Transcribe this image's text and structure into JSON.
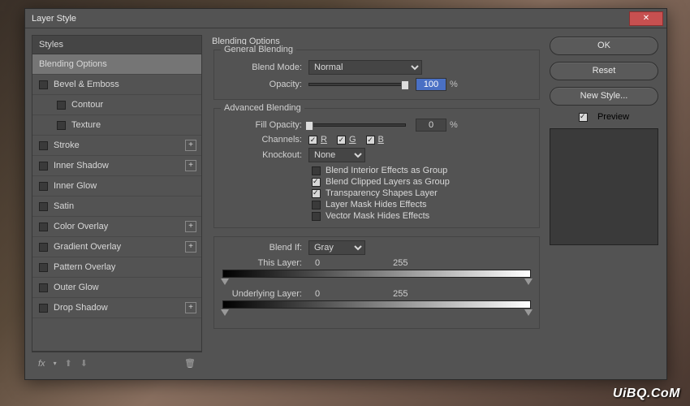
{
  "dialog": {
    "title": "Layer Style"
  },
  "sidebar": {
    "header": "Styles",
    "items": [
      {
        "label": "Blending Options",
        "selected": true,
        "checkbox": false
      },
      {
        "label": "Bevel & Emboss",
        "checkbox": true
      },
      {
        "label": "Contour",
        "checkbox": true,
        "sub": true
      },
      {
        "label": "Texture",
        "checkbox": true,
        "sub": true
      },
      {
        "label": "Stroke",
        "checkbox": true,
        "plus": true
      },
      {
        "label": "Inner Shadow",
        "checkbox": true,
        "plus": true
      },
      {
        "label": "Inner Glow",
        "checkbox": true
      },
      {
        "label": "Satin",
        "checkbox": true
      },
      {
        "label": "Color Overlay",
        "checkbox": true,
        "plus": true
      },
      {
        "label": "Gradient Overlay",
        "checkbox": true,
        "plus": true
      },
      {
        "label": "Pattern Overlay",
        "checkbox": true
      },
      {
        "label": "Outer Glow",
        "checkbox": true
      },
      {
        "label": "Drop Shadow",
        "checkbox": true,
        "plus": true
      }
    ],
    "fx_label": "fx"
  },
  "content": {
    "section_title": "Blending Options",
    "general": {
      "legend": "General Blending",
      "blend_mode_label": "Blend Mode:",
      "blend_mode_value": "Normal",
      "opacity_label": "Opacity:",
      "opacity_value": "100",
      "opacity_unit": "%"
    },
    "advanced": {
      "legend": "Advanced Blending",
      "fill_opacity_label": "Fill Opacity:",
      "fill_opacity_value": "0",
      "fill_opacity_unit": "%",
      "channels_label": "Channels:",
      "channels": [
        "R",
        "G",
        "B"
      ],
      "knockout_label": "Knockout:",
      "knockout_value": "None",
      "opts": [
        {
          "label": "Blend Interior Effects as Group",
          "checked": false
        },
        {
          "label": "Blend Clipped Layers as Group",
          "checked": true
        },
        {
          "label": "Transparency Shapes Layer",
          "checked": true
        },
        {
          "label": "Layer Mask Hides Effects",
          "checked": false
        },
        {
          "label": "Vector Mask Hides Effects",
          "checked": false
        }
      ]
    },
    "blendif": {
      "legend_label": "Blend If:",
      "channel": "Gray",
      "this_layer_label": "This Layer:",
      "this_vals": [
        "0",
        "255"
      ],
      "under_label": "Underlying Layer:",
      "under_vals": [
        "0",
        "255"
      ]
    }
  },
  "buttons": {
    "ok": "OK",
    "reset": "Reset",
    "new_style": "New Style...",
    "preview": "Preview"
  },
  "watermark": "UiBQ.CoM"
}
